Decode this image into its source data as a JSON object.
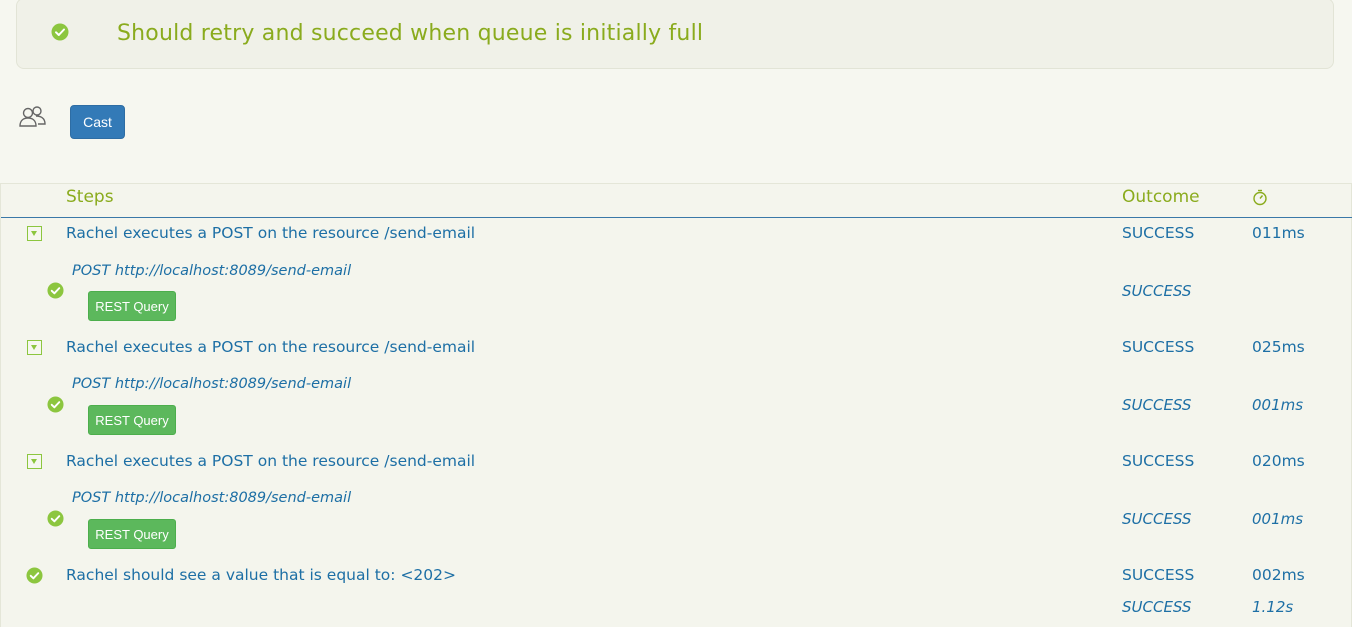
{
  "title": "Should retry and succeed when queue is initially full",
  "cast_button": "Cast",
  "table": {
    "header_steps": "Steps",
    "header_outcome": "Outcome"
  },
  "steps": [
    {
      "text": "Rachel executes a POST on the resource /send-email",
      "outcome": "SUCCESS",
      "duration": "011ms",
      "sub": {
        "text": "POST http://localhost:8089/send-email",
        "outcome": "SUCCESS",
        "duration": "",
        "button": "REST Query"
      }
    },
    {
      "text": "Rachel executes a POST on the resource /send-email",
      "outcome": "SUCCESS",
      "duration": "025ms",
      "sub": {
        "text": "POST http://localhost:8089/send-email",
        "outcome": "SUCCESS",
        "duration": "001ms",
        "button": "REST Query"
      }
    },
    {
      "text": "Rachel executes a POST on the resource /send-email",
      "outcome": "SUCCESS",
      "duration": "020ms",
      "sub": {
        "text": "POST http://localhost:8089/send-email",
        "outcome": "SUCCESS",
        "duration": "001ms",
        "button": "REST Query"
      }
    },
    {
      "text": "Rachel should see a value that is equal to: <202>",
      "outcome": "SUCCESS",
      "duration": "002ms"
    }
  ],
  "total": {
    "outcome": "SUCCESS",
    "duration": "1.12s"
  },
  "colors": {
    "accent_green": "#8aab1d",
    "link_blue": "#1d6fa5",
    "check_green": "#8cc63f",
    "cast_blue": "#337ab7",
    "rest_green": "#5cb85c"
  },
  "icons": [
    "check-circle-icon",
    "people-icon",
    "stopwatch-icon",
    "expand-toggle-icon"
  ]
}
